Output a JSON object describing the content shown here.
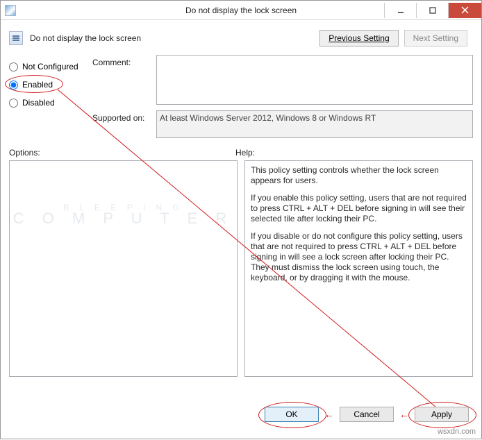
{
  "window": {
    "title": "Do not display the lock screen"
  },
  "header": {
    "policy_name": "Do not display the lock screen",
    "prev_button": "Previous Setting",
    "next_button": "Next Setting"
  },
  "radios": {
    "not_configured": "Not Configured",
    "enabled": "Enabled",
    "disabled": "Disabled",
    "selected": "enabled"
  },
  "form": {
    "comment_label": "Comment:",
    "comment_value": "",
    "supported_label": "Supported on:",
    "supported_value": "At least Windows Server 2012, Windows 8 or Windows RT"
  },
  "panels": {
    "options_label": "Options:",
    "help_label": "Help:",
    "help_p1": "This policy setting controls whether the lock screen appears for users.",
    "help_p2": "If you enable this policy setting, users that are not required to press CTRL + ALT + DEL before signing in will see their selected tile after  locking their PC.",
    "help_p3": "If you disable or do not configure this policy setting, users that are not required to press CTRL + ALT + DEL before signing in will see a lock screen after locking their PC. They must dismiss the lock screen using touch, the keyboard, or by dragging it with the mouse."
  },
  "footer": {
    "ok": "OK",
    "cancel": "Cancel",
    "apply": "Apply"
  },
  "watermark": {
    "l1": "B L E E P I N G",
    "l2": "C O M P U T E R"
  },
  "domain_mark": "wsxdn.com"
}
